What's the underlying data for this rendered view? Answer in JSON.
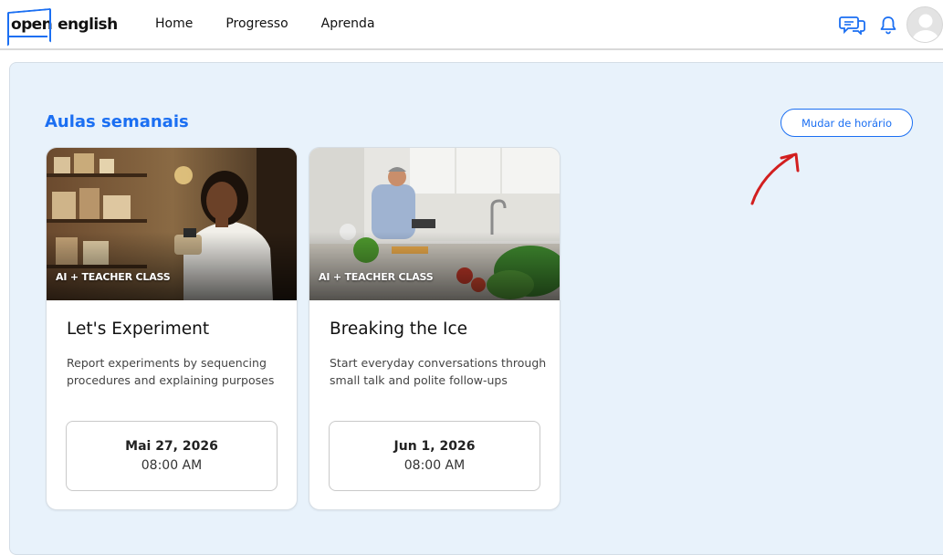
{
  "brand": {
    "open": "open",
    "english": "english",
    "accent": "#1b6ff2"
  },
  "nav": {
    "items": [
      {
        "label": "Home"
      },
      {
        "label": "Progresso"
      },
      {
        "label": "Aprenda"
      }
    ]
  },
  "header_icons": {
    "chat": "chat-bubbles-icon",
    "notifications": "bell-icon",
    "profile": "avatar-icon"
  },
  "section": {
    "title": "Aulas semanais",
    "change_schedule_label": "Mudar de horário",
    "annotation_color": "#d21f1f"
  },
  "cards": [
    {
      "tag": "AI + TEACHER CLASS",
      "title": "Let's Experiment",
      "description": "Report experiments by sequencing procedures and explaining purposes",
      "date": "Mai 27, 2026",
      "time": "08:00 AM"
    },
    {
      "tag": "AI + TEACHER CLASS",
      "title": "Breaking the Ice",
      "description": "Start everyday conversations through small talk and polite follow-ups",
      "date": "Jun 1, 2026",
      "time": "08:00 AM"
    }
  ]
}
